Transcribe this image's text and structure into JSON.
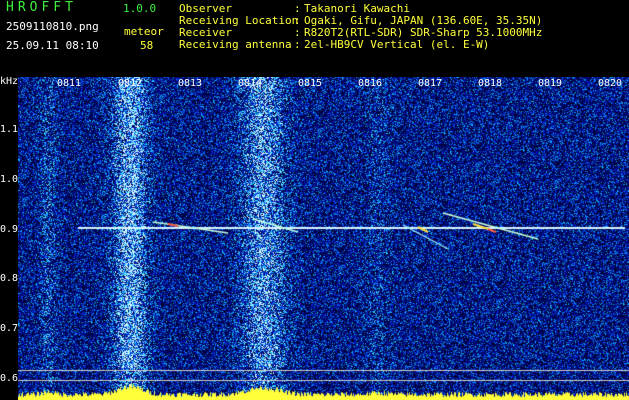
{
  "app": {
    "title": "HROFFT",
    "version": "1.0.0"
  },
  "file": {
    "name": "2509110810.png"
  },
  "mode": {
    "label": "meteor"
  },
  "datetime": "25.09.11 08:10",
  "meteor_count": "58",
  "info": [
    {
      "label": "Observer",
      "value": "Takanori Kawachi"
    },
    {
      "label": "Receiving Location",
      "value": "Ogaki, Gifu, JAPAN (136.60E, 35.35N)"
    },
    {
      "label": "Receiver",
      "value": "R820T2(RTL-SDR) SDR-Sharp 53.1000MHz"
    },
    {
      "label": "Receiving antenna",
      "value": "2el-HB9CV Vertical (el. E-W)"
    }
  ],
  "axis": {
    "unit": "kHz",
    "y_ticks": [
      "1.1",
      "1.0",
      "0.9",
      "0.8",
      "0.7",
      "0.6"
    ],
    "x_ticks": [
      "0811",
      "0812",
      "0813",
      "0814",
      "0815",
      "0816",
      "0817",
      "0818",
      "0819",
      "0820"
    ]
  },
  "colors": {
    "accent_green": "#3df03d",
    "label_yellow": "#ffff3a",
    "carrier": "#d8f4ff"
  }
}
